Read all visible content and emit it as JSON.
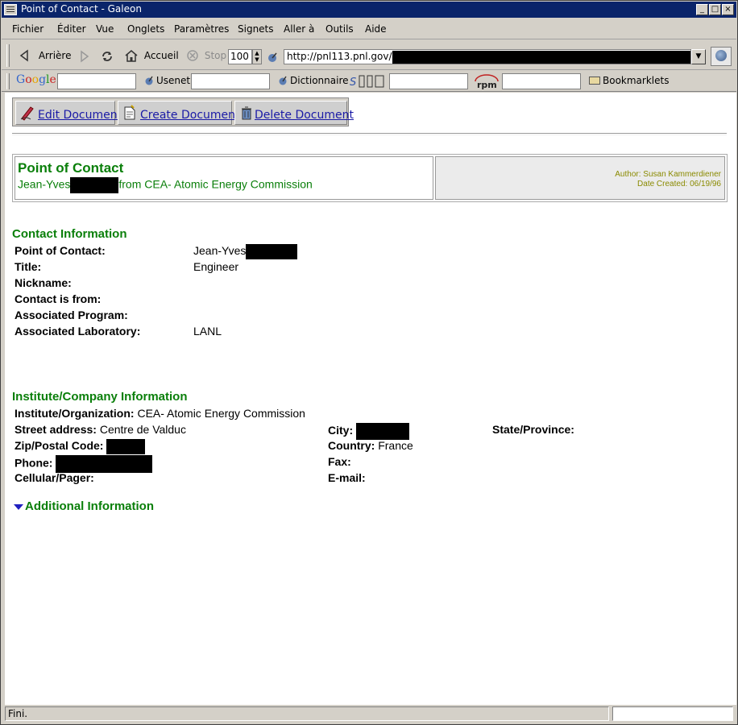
{
  "window": {
    "title": "Point of Contact - Galeon",
    "minimize": "_",
    "maximize": "□",
    "close": "×"
  },
  "menu": [
    "Fichier",
    "Éditer",
    "Vue",
    "Onglets",
    "Paramètres",
    "Signets",
    "Aller à",
    "Outils",
    "Aide"
  ],
  "nav": {
    "back": "Arrière",
    "home": "Accueil",
    "stop": "Stop",
    "zoom": "100",
    "url": "http://pnl113.pnl.gov/"
  },
  "search": {
    "usenet": "Usenet",
    "dictionary": "Dictionnaire",
    "bookmarklets": "Bookmarklets"
  },
  "doc_buttons": {
    "edit": "Edit Document",
    "create": "Create Document",
    "delete": "Delete Document"
  },
  "header": {
    "title": "Point of Contact",
    "name_first": "Jean-Yves",
    "from_text": "from CEA- Atomic Energy Commission",
    "author": "Author: Susan Kammerdiener",
    "date_created": "Date Created: 06/19/96"
  },
  "contact": {
    "section_title": "Contact Information",
    "fields": [
      {
        "label": "Point of Contact:",
        "value": "Jean-Yves"
      },
      {
        "label": "Title:",
        "value": "Engineer"
      },
      {
        "label": "Nickname:",
        "value": ""
      },
      {
        "label": "Contact is from:",
        "value": ""
      },
      {
        "label": "Associated Program:",
        "value": ""
      },
      {
        "label": "Associated Laboratory:",
        "value": "LANL"
      }
    ]
  },
  "institute": {
    "section_title": "Institute/Company Information",
    "org_label": "Institute/Organization:",
    "org_value": "CEA- Atomic Energy Commission",
    "street_label": "Street address:",
    "street_value": "Centre de Valduc",
    "city_label": "City:",
    "state_label": "State/Province:",
    "zip_label": "Zip/Postal Code:",
    "country_label": "Country:",
    "country_value": "France",
    "phone_label": "Phone:",
    "fax_label": "Fax:",
    "cell_label": "Cellular/Pager:",
    "email_label": "E-mail:"
  },
  "additional": {
    "section_title": "Additional Information"
  },
  "status": {
    "text": "Fini."
  }
}
